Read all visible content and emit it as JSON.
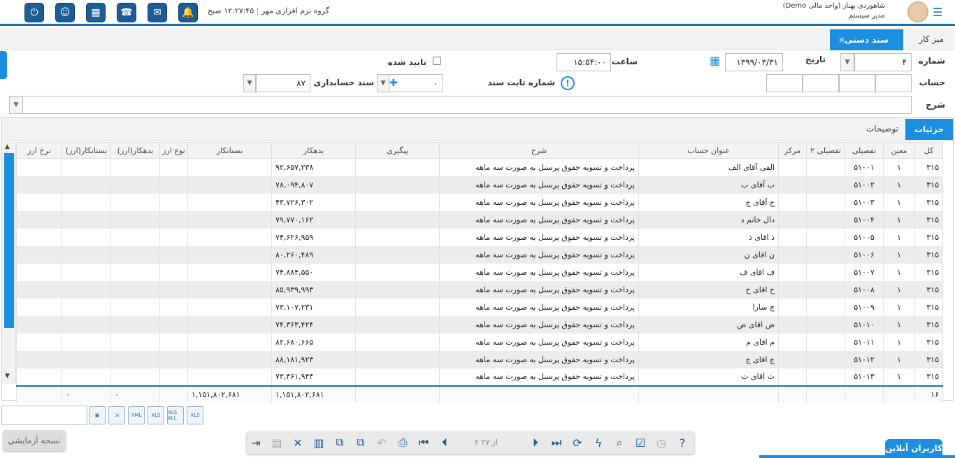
{
  "header": {
    "company": "گروه نرم افزاری مهر",
    "time": "۱۲:۲۷:۴۵ صبح",
    "user_name": "شاهوردی پهناز (واحد مالی Demo)",
    "user_role": "مدیر سیستم",
    "icons": [
      "power-icon",
      "robot-icon",
      "dashboard-icon",
      "phone-icon",
      "mail-icon",
      "bell-icon"
    ]
  },
  "tabs": {
    "desk": "میز کار",
    "active": "سند دستی",
    "close": "×"
  },
  "form": {
    "number_label": "شماره",
    "number_value": "۴",
    "date_label": "تاریخ",
    "date_value": "۱۳۹۹/۰۳/۳۱",
    "time_label": "ساعت",
    "time_value": "۱۵:۵۴:۰۰",
    "approved_label": "تایید شده",
    "account_label": "حساب",
    "fixed_number_label": "شماره ثابت سند",
    "fixed_number_value": "۰",
    "acc_doc_label": "سند حسابداری",
    "acc_doc_value": "۸۷",
    "desc_label": "شرح"
  },
  "grid_tabs": {
    "details": "جزئیات",
    "notes": "توضیحات"
  },
  "columns": [
    "کل",
    "معین",
    "تفصیلی",
    "تفصیلی ۲",
    "مرکز",
    "عنوان حساب",
    "شرح",
    "پیگیری",
    "بدهکار",
    "بستانکار",
    "نوع ارز",
    "بدهکار(ارز)",
    "بستانکار(ارز)",
    "نرخ ارز"
  ],
  "rows": [
    {
      "kol": "۳۱۵",
      "moin": "۱",
      "tafsili": "۵۱۰۰۱",
      "title": "الفی آقای الف",
      "sharh": "پرداخت و تسویه حقوق پرسنل به صورت سه ماهه",
      "debit": "۹۲,۶۵۷,۲۳۸"
    },
    {
      "kol": "۳۱۵",
      "moin": "۱",
      "tafsili": "۵۱۰۰۲",
      "title": "ب آقای ب",
      "sharh": "پرداخت و تسویه حقوق پرسنل به صورت سه ماهه",
      "debit": "۷۸,۰۹۴,۸۰۷"
    },
    {
      "kol": "۳۱۵",
      "moin": "۱",
      "tafsili": "۵۱۰۰۳",
      "title": "ج آقای ج",
      "sharh": "پرداخت و تسویه حقوق پرسنل به صورت سه ماهه",
      "debit": "۴۳,۷۲۶,۳۰۲"
    },
    {
      "kol": "۳۱۵",
      "moin": "۱",
      "tafsili": "۵۱۰۰۴",
      "title": "دال خانم د",
      "sharh": "پرداخت و تسویه حقوق پرسنل به صورت سه ماهه",
      "debit": "۷۹,۷۷۰,۱۶۲"
    },
    {
      "kol": "۳۱۵",
      "moin": "۱",
      "tafsili": "۵۱۰۰۵",
      "title": "ذ اقای ذ",
      "sharh": "پرداخت و تسویه حقوق پرسنل به صورت سه ماهه",
      "debit": "۷۴,۶۲۶,۹۵۹"
    },
    {
      "kol": "۳۱۵",
      "moin": "۱",
      "tafsili": "۵۱۰۰۶",
      "title": "ن اقای ن",
      "sharh": "پرداخت و تسویه حقوق پرسنل به صورت سه ماهه",
      "debit": "۸۰,۲۶۰,۴۸۹"
    },
    {
      "kol": "۳۱۵",
      "moin": "۱",
      "tafsili": "۵۱۰۰۷",
      "title": "ف اقای ف",
      "sharh": "پرداخت و تسویه حقوق پرسنل به صورت سه ماهه",
      "debit": "۷۴,۸۸۴,۵۵۰"
    },
    {
      "kol": "۳۱۵",
      "moin": "۱",
      "tafsili": "۵۱۰۰۸",
      "title": "خ اقای خ",
      "sharh": "پرداخت و تسویه حقوق پرسنل به صورت سه ماهه",
      "debit": "۸۵,۹۳۹,۹۹۳"
    },
    {
      "kol": "۳۱۵",
      "moin": "۱",
      "tafsili": "۵۱۰۰۹",
      "title": "چ سارا",
      "sharh": "پرداخت و تسویه حقوق پرسنل به صورت سه ماهه",
      "debit": "۷۳,۱۰۷,۲۳۱"
    },
    {
      "kol": "۳۱۵",
      "moin": "۱",
      "tafsili": "۵۱۰۱۰",
      "title": "ض اقای ض",
      "sharh": "پرداخت و تسویه حقوق پرسنل به صورت سه ماهه",
      "debit": "۷۴,۳۶۳,۴۲۴"
    },
    {
      "kol": "۳۱۵",
      "moin": "۱",
      "tafsili": "۵۱۰۱۱",
      "title": "م اقای م",
      "sharh": "پرداخت و تسویه حقوق پرسنل به صورت سه ماهه",
      "debit": "۸۲,۶۸۰,۶۶۵"
    },
    {
      "kol": "۳۱۵",
      "moin": "۱",
      "tafsili": "۵۱۰۱۲",
      "title": "چ اقای چ",
      "sharh": "پرداخت و تسویه حقوق پرسنل به صورت سه ماهه",
      "debit": "۸۸,۱۸۱,۹۲۳"
    },
    {
      "kol": "۳۱۵",
      "moin": "۱",
      "tafsili": "۵۱۰۱۳",
      "title": "ث اقای ث",
      "sharh": "پرداخت و تسویه حقوق پرسنل به صورت سه ماهه",
      "debit": "۷۳,۴۶۱,۹۴۴"
    }
  ],
  "footer": {
    "count": "۱۶",
    "debit_total": "۱,۱۵۱,۸۰۲,۶۸۱",
    "credit_total": "۱,۱۵۱,۸۰۲,۶۸۱",
    "fx_debit": "۰",
    "fx_credit": "۰"
  },
  "toolbar": {
    "pager": "۲ از ۲۷"
  },
  "trial": "نسخه آزمایشی",
  "online": "کاربران آنلاین",
  "export_buttons": [
    "XLS",
    "XLS ALL",
    "XLS",
    "XML"
  ],
  "colors": {
    "accent": "#1c8ee0",
    "dark": "#1d5d96"
  }
}
